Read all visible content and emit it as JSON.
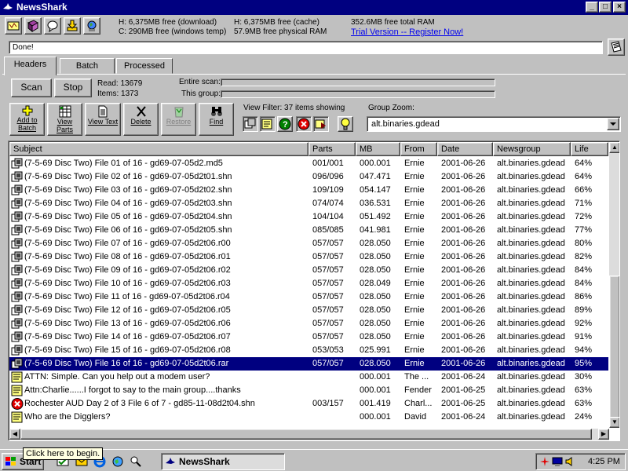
{
  "window": {
    "title": "NewsShark"
  },
  "toolbar_icons": [
    "preferences-icon",
    "book-icon",
    "chat-icon",
    "download-icon",
    "globe-icon"
  ],
  "info": {
    "line1a": "H: 6,375MB free (download)",
    "line1b": "C: 290MB free (windows temp)",
    "line2a": "H: 6,375MB free (cache)",
    "line2b": "57.9MB free physical RAM",
    "line3a": "352.6MB free total RAM",
    "trial": "Trial Version -- Register Now!"
  },
  "status_text": "Done!",
  "tabs": [
    {
      "label": "Headers"
    },
    {
      "label": "Batch"
    },
    {
      "label": "Processed"
    }
  ],
  "scan": {
    "scan_label": "Scan",
    "stop_label": "Stop",
    "read_label": "Read: 13679",
    "items_label": "Items: 1373",
    "entire_scan_label": "Entire scan:",
    "this_group_label": "This group:"
  },
  "actions": [
    {
      "l1": "Add to",
      "l2": "Batch"
    },
    {
      "l1": "View",
      "l2": "Parts"
    },
    {
      "l1": "View Text",
      "l2": ""
    },
    {
      "l1": "Delete",
      "l2": ""
    },
    {
      "l1": "Restore",
      "l2": ""
    },
    {
      "l1": "Find",
      "l2": ""
    }
  ],
  "view_filter": {
    "label": "View Filter: 37 items showing"
  },
  "group_zoom": {
    "label": "Group Zoom:",
    "value": "alt.binaries.gdead"
  },
  "columns": [
    "Subject",
    "Parts",
    "MB",
    "From",
    "Date",
    "Newsgroup",
    "Life"
  ],
  "rows": [
    {
      "icon": "multipart",
      "subject": "(7-5-69 Disc Two) File 01 of 16 - gd69-07-05d2.md5",
      "parts": "001/001",
      "mb": "000.001",
      "from": "Ernie",
      "date": "2001-06-26",
      "group": "alt.binaries.gdead",
      "life": "64%"
    },
    {
      "icon": "multipart",
      "subject": "(7-5-69 Disc Two) File 02 of 16 - gd69-07-05d2t01.shn",
      "parts": "096/096",
      "mb": "047.471",
      "from": "Ernie",
      "date": "2001-06-26",
      "group": "alt.binaries.gdead",
      "life": "64%"
    },
    {
      "icon": "multipart",
      "subject": "(7-5-69 Disc Two) File 03 of 16 - gd69-07-05d2t02.shn",
      "parts": "109/109",
      "mb": "054.147",
      "from": "Ernie",
      "date": "2001-06-26",
      "group": "alt.binaries.gdead",
      "life": "66%"
    },
    {
      "icon": "multipart",
      "subject": "(7-5-69 Disc Two) File 04 of 16 - gd69-07-05d2t03.shn",
      "parts": "074/074",
      "mb": "036.531",
      "from": "Ernie",
      "date": "2001-06-26",
      "group": "alt.binaries.gdead",
      "life": "71%"
    },
    {
      "icon": "multipart",
      "subject": "(7-5-69 Disc Two) File 05 of 16 - gd69-07-05d2t04.shn",
      "parts": "104/104",
      "mb": "051.492",
      "from": "Ernie",
      "date": "2001-06-26",
      "group": "alt.binaries.gdead",
      "life": "72%"
    },
    {
      "icon": "multipart",
      "subject": "(7-5-69 Disc Two) File 06 of 16 - gd69-07-05d2t05.shn",
      "parts": "085/085",
      "mb": "041.981",
      "from": "Ernie",
      "date": "2001-06-26",
      "group": "alt.binaries.gdead",
      "life": "77%"
    },
    {
      "icon": "multipart",
      "subject": "(7-5-69 Disc Two) File 07 of 16 - gd69-07-05d2t06.r00",
      "parts": "057/057",
      "mb": "028.050",
      "from": "Ernie",
      "date": "2001-06-26",
      "group": "alt.binaries.gdead",
      "life": "80%"
    },
    {
      "icon": "multipart",
      "subject": "(7-5-69 Disc Two) File 08 of 16 - gd69-07-05d2t06.r01",
      "parts": "057/057",
      "mb": "028.050",
      "from": "Ernie",
      "date": "2001-06-26",
      "group": "alt.binaries.gdead",
      "life": "82%"
    },
    {
      "icon": "multipart",
      "subject": "(7-5-69 Disc Two) File 09 of 16 - gd69-07-05d2t06.r02",
      "parts": "057/057",
      "mb": "028.050",
      "from": "Ernie",
      "date": "2001-06-26",
      "group": "alt.binaries.gdead",
      "life": "84%"
    },
    {
      "icon": "multipart",
      "subject": "(7-5-69 Disc Two) File 10 of 16 - gd69-07-05d2t06.r03",
      "parts": "057/057",
      "mb": "028.049",
      "from": "Ernie",
      "date": "2001-06-26",
      "group": "alt.binaries.gdead",
      "life": "84%"
    },
    {
      "icon": "multipart",
      "subject": "(7-5-69 Disc Two) File 11 of 16 - gd69-07-05d2t06.r04",
      "parts": "057/057",
      "mb": "028.050",
      "from": "Ernie",
      "date": "2001-06-26",
      "group": "alt.binaries.gdead",
      "life": "86%"
    },
    {
      "icon": "multipart",
      "subject": "(7-5-69 Disc Two) File 12 of 16 - gd69-07-05d2t06.r05",
      "parts": "057/057",
      "mb": "028.050",
      "from": "Ernie",
      "date": "2001-06-26",
      "group": "alt.binaries.gdead",
      "life": "89%"
    },
    {
      "icon": "multipart",
      "subject": "(7-5-69 Disc Two) File 13 of 16 - gd69-07-05d2t06.r06",
      "parts": "057/057",
      "mb": "028.050",
      "from": "Ernie",
      "date": "2001-06-26",
      "group": "alt.binaries.gdead",
      "life": "92%"
    },
    {
      "icon": "multipart",
      "subject": "(7-5-69 Disc Two) File 14 of 16 - gd69-07-05d2t06.r07",
      "parts": "057/057",
      "mb": "028.050",
      "from": "Ernie",
      "date": "2001-06-26",
      "group": "alt.binaries.gdead",
      "life": "91%"
    },
    {
      "icon": "multipart",
      "subject": "(7-5-69 Disc Two) File 15 of 16 - gd69-07-05d2t06.r08",
      "parts": "053/053",
      "mb": "025.991",
      "from": "Ernie",
      "date": "2001-06-26",
      "group": "alt.binaries.gdead",
      "life": "94%"
    },
    {
      "icon": "multipart",
      "subject": "(7-5-69 Disc Two) File 16 of 16 - gd69-07-05d2t06.rar",
      "parts": "057/057",
      "mb": "028.050",
      "from": "Ernie",
      "date": "2001-06-26",
      "group": "alt.binaries.gdead",
      "life": "95%",
      "selected": true
    },
    {
      "icon": "text",
      "subject": "ATTN: Simple. Can you help out a modem user?",
      "parts": "",
      "mb": "000.001",
      "from": "The ...",
      "date": "2001-06-24",
      "group": "alt.binaries.gdead",
      "life": "30%"
    },
    {
      "icon": "text",
      "subject": "Attn:Charlie......I forgot to say to the main group....thanks",
      "parts": "",
      "mb": "000.001",
      "from": "Fender",
      "date": "2001-06-25",
      "group": "alt.binaries.gdead",
      "life": "63%"
    },
    {
      "icon": "error",
      "subject": "Rochester AUD Day 2 of 3 File 6 of 7 - gd85-11-08d2t04.shn",
      "parts": "003/157",
      "mb": "001.419",
      "from": "Charl...",
      "date": "2001-06-25",
      "group": "alt.binaries.gdead",
      "life": "63%"
    },
    {
      "icon": "text",
      "subject": "Who are the Digglers?",
      "parts": "",
      "mb": "000.001",
      "from": "David",
      "date": "2001-06-24",
      "group": "alt.binaries.gdead",
      "life": "24%"
    }
  ],
  "taskbar": {
    "start": "Start",
    "tooltip": "Click here to begin.",
    "task": "NewsShark",
    "clock": "4:25 PM"
  }
}
